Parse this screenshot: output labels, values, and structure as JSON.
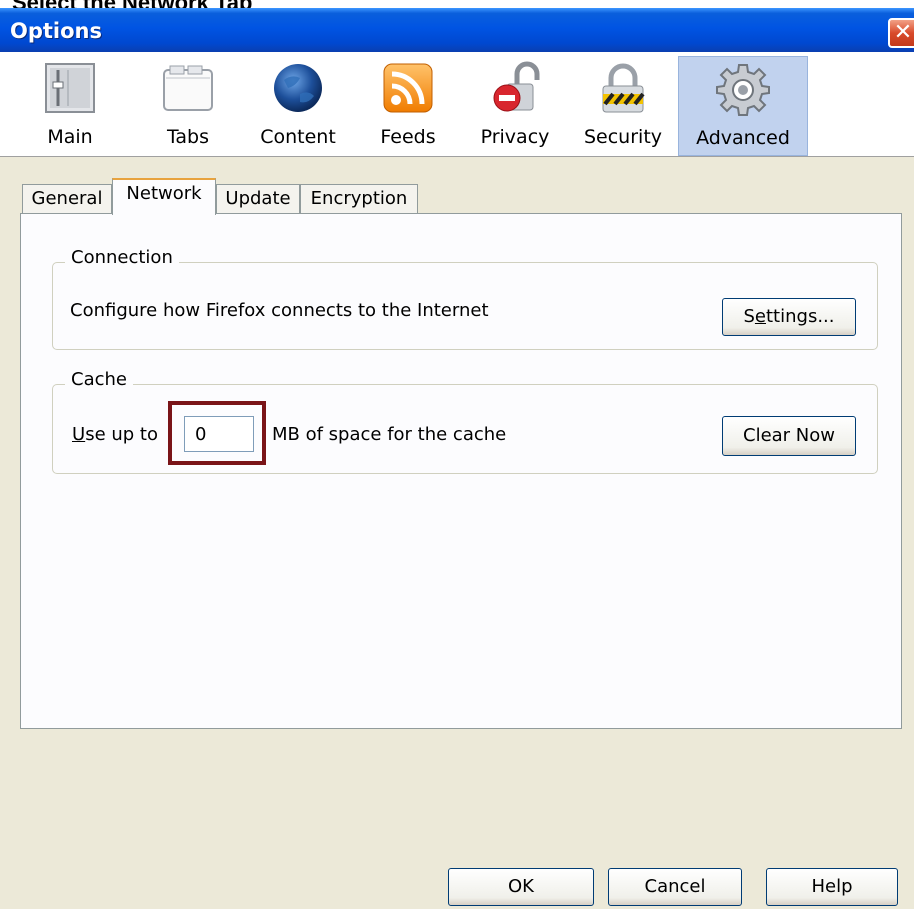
{
  "caption": "Select the Network Tab",
  "window": {
    "title": "Options",
    "close_glyph": "✕"
  },
  "toolbar": {
    "panes": [
      {
        "label": "Main",
        "icon": "main-icon"
      },
      {
        "label": "Tabs",
        "icon": "tabs-icon"
      },
      {
        "label": "Content",
        "icon": "globe-icon"
      },
      {
        "label": "Feeds",
        "icon": "rss-feed-icon"
      },
      {
        "label": "Privacy",
        "icon": "privacy-lock-icon"
      },
      {
        "label": "Security",
        "icon": "security-padlock-icon"
      },
      {
        "label": "Advanced",
        "icon": "gear-icon",
        "selected": true
      }
    ]
  },
  "tabs": [
    {
      "label": "General"
    },
    {
      "label": "Network",
      "active": true
    },
    {
      "label": "Update"
    },
    {
      "label": "Encryption"
    }
  ],
  "connection": {
    "legend": "Connection",
    "description": "Configure how Firefox connects to the Internet",
    "settings_button_prefix": "S",
    "settings_button_accel": "e",
    "settings_button_suffix": "ttings..."
  },
  "cache": {
    "legend": "Cache",
    "use_up_to_accel": "U",
    "use_up_to_rest": "se up to",
    "size_value": "0",
    "size_suffix": "MB of space for the cache",
    "clear_button": "Clear Now"
  },
  "footer": {
    "ok": "OK",
    "cancel": "Cancel",
    "help": "Help"
  },
  "colors": {
    "titlebar": "#0054e3",
    "selected_pane": "#c1d2ee",
    "highlight_box": "#7a1418",
    "window_bg": "#ece9d8"
  }
}
